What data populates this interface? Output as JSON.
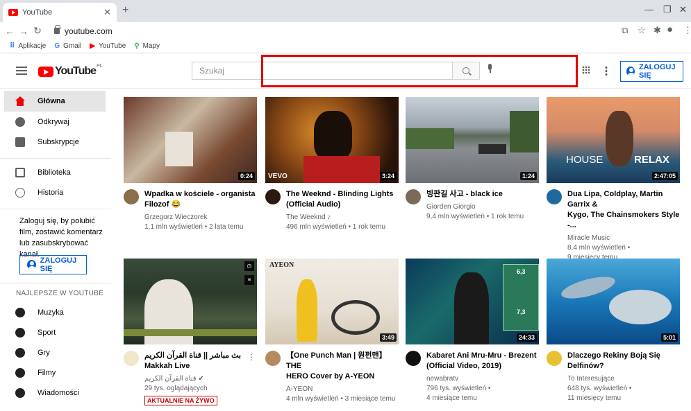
{
  "browser": {
    "tab_title": "YouTube",
    "tab_close": "✕",
    "new_tab": "+",
    "url": "youtube.com",
    "bookmarks": [
      {
        "label": "Aplikacje"
      },
      {
        "label": "Gmail"
      },
      {
        "label": "YouTube"
      },
      {
        "label": "Mapy"
      }
    ]
  },
  "masthead": {
    "logo_text": "YouTube",
    "logo_country": "PL",
    "search_placeholder": "Szukaj",
    "signin_label": "ZALOGUJ SIĘ"
  },
  "sidebar": {
    "items": [
      {
        "label": "Główna"
      },
      {
        "label": "Odkrywaj"
      },
      {
        "label": "Subskrypcje"
      },
      {
        "label": "Biblioteka"
      },
      {
        "label": "Historia"
      }
    ],
    "signin_prompt": "Zaloguj się, by polubić film, zostawić komentarz lub zasubskrybować kanał.",
    "signin_label": "ZALOGUJ SIĘ",
    "best_heading": "NAJLEPSZE W YOUTUBE",
    "best_items": [
      {
        "label": "Muzyka"
      },
      {
        "label": "Sport"
      },
      {
        "label": "Gry"
      },
      {
        "label": "Filmy"
      },
      {
        "label": "Wiadomości"
      }
    ]
  },
  "videos": [
    {
      "title1": "Wpadka w kościele - organista",
      "title2": "Filozof 😂",
      "channel": "Grzegorz Wieczorek",
      "stats1": "1,1 mln wyświetleń • 2 lata temu",
      "stats2": "",
      "duration": "0:24"
    },
    {
      "title1": "The Weeknd - Blinding Lights",
      "title2": "(Official Audio)",
      "channel": "The Weeknd ♪",
      "stats1": "496 mln wyświetleń • 1 rok temu",
      "stats2": "",
      "duration": "3:24",
      "overlay": "VEVO"
    },
    {
      "title1": "빙판길 사고 - black ice",
      "title2": "",
      "channel": "Giorden Giorgio",
      "stats1": "9,4 mln wyświetleń • 1 rok temu",
      "stats2": "",
      "duration": "1:24"
    },
    {
      "title1": "Dua Lipa, Coldplay, Martin Garrix &",
      "title2": "Kygo, The Chainsmokers Style -...",
      "channel": "Miracle Music",
      "stats1": "8,4 mln wyświetleń •",
      "stats2": "9 miesięcy temu",
      "duration": "2:47:05",
      "overlay_left": "HOUSE",
      "overlay_right": "RELAX"
    },
    {
      "title1": "بث مباشر || قناة القرآن الكريم Makkah Live",
      "title2": "",
      "channel": "قناة القرآن الكريم ✔",
      "stats1": "29 tys. oglądających",
      "stats2": "",
      "duration": "",
      "badge": "AKTUALNIE NA ŻYWO"
    },
    {
      "title1": "【One Punch Man | 원펀맨】 THE",
      "title2": "HERO Cover by A-YEON",
      "channel": "A-YEON",
      "stats1": "4 mln wyświetleń • 3 miesiące temu",
      "stats2": "",
      "duration": "3:49",
      "overlay": "AYEON"
    },
    {
      "title1": "Kabaret Ani Mru-Mru - Brezent",
      "title2": "(Official Video, 2019)",
      "channel": "newabratv",
      "stats1": "796 tys. wyświetleń •",
      "stats2": "4 miesiące temu",
      "duration": "24:33",
      "overlay_a": "6,3",
      "overlay_b": "7,3"
    },
    {
      "title1": "Dlaczego Rekiny Boją Się Delfinów?",
      "title2": "",
      "channel": "To Interesujące",
      "stats1": "648 tys. wyświetleń •",
      "stats2": "11 miesięcy temu",
      "duration": "5:01"
    }
  ],
  "colors": {
    "accent_red": "#ff0000",
    "link_blue": "#065fd4",
    "highlight": "#e00000"
  }
}
